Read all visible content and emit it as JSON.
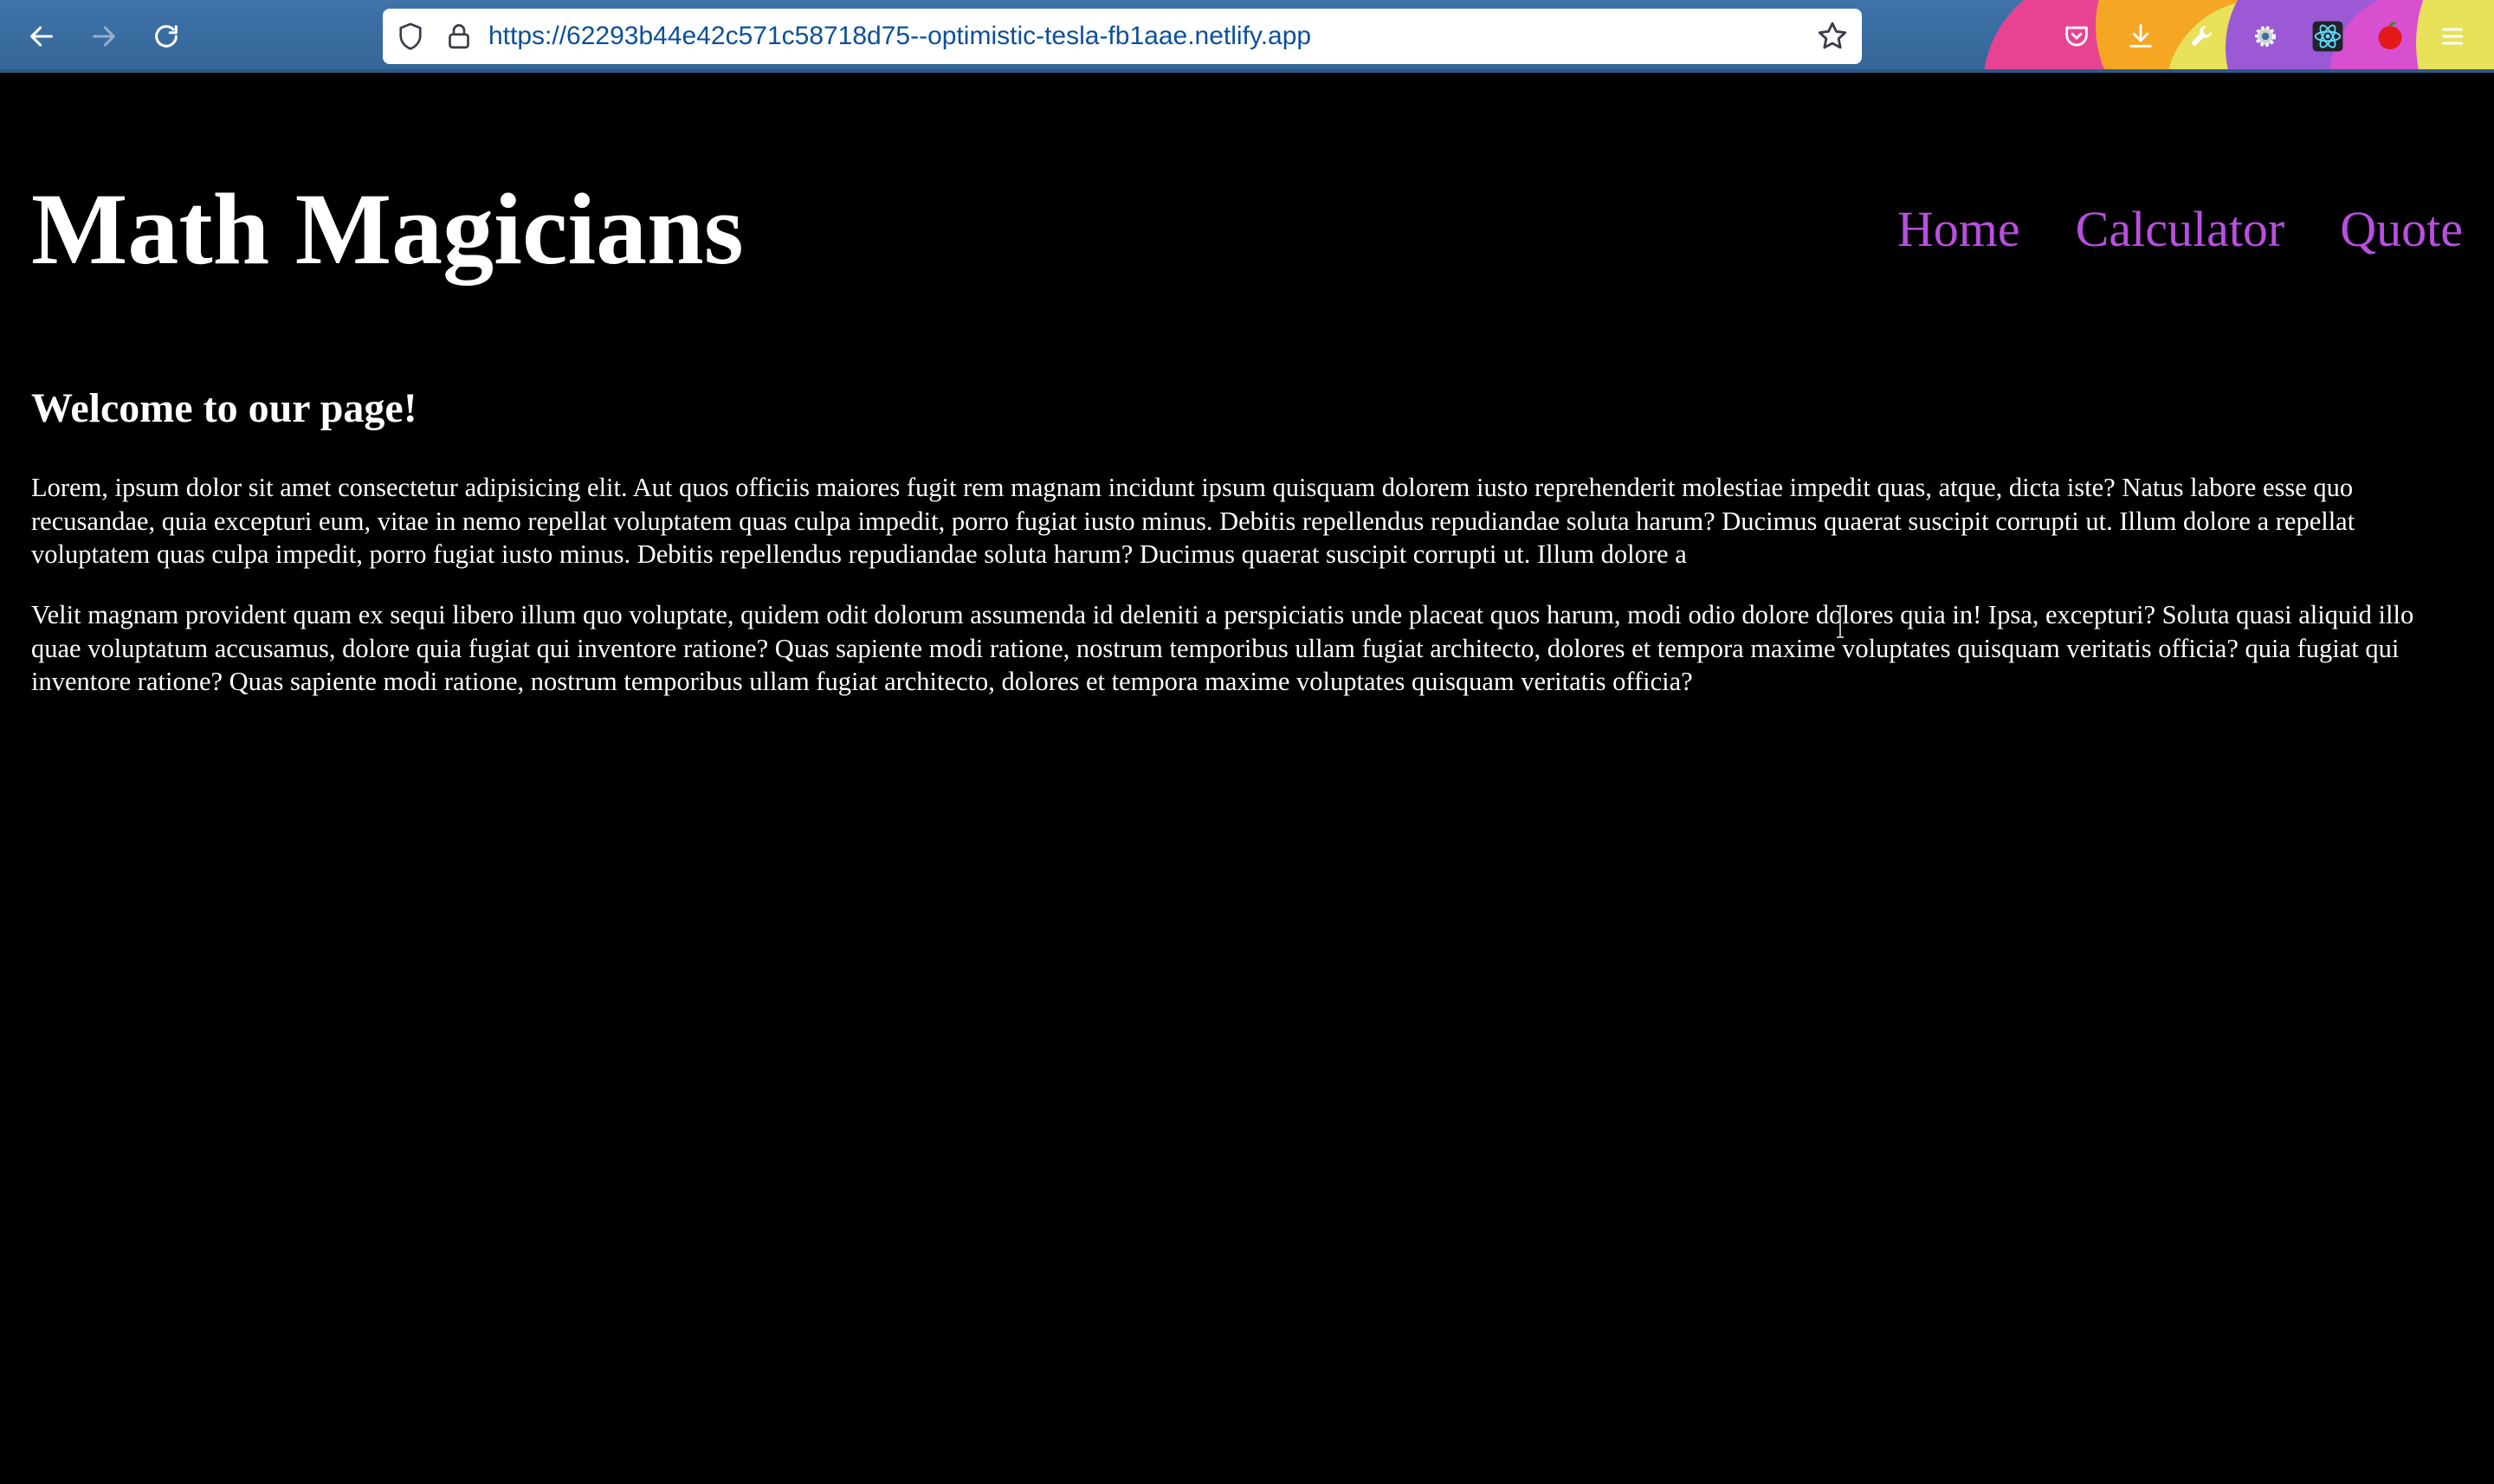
{
  "browser": {
    "url": "https://62293b44e42c571c58718d75--optimistic-tesla-fb1aae.netlify.app",
    "back_icon": "arrow-left-icon",
    "forward_icon": "arrow-right-icon",
    "reload_icon": "reload-icon",
    "toolbar_icons": [
      "pocket-icon",
      "download-icon",
      "wrench-icon",
      "gear-icon",
      "react-devtools-icon",
      "extension-icon",
      "menu-icon"
    ],
    "toolbar_color": "#3a6ea5"
  },
  "site": {
    "logo": "Math Magicians",
    "nav": [
      "Home",
      "Calculator",
      "Quote"
    ],
    "nav_color": "#b94fe0"
  },
  "content": {
    "heading": "Welcome to our page!",
    "paragraph1": "Lorem, ipsum dolor sit amet consectetur adipisicing elit. Aut quos officiis maiores fugit rem magnam incidunt ipsum quisquam dolorem iusto reprehenderit molestiae impedit quas, atque, dicta iste? Natus labore esse quo recusandae, quia excepturi eum, vitae in nemo repellat voluptatem quas culpa impedit, porro fugiat iusto minus. Debitis repellendus repudiandae soluta harum? Ducimus quaerat suscipit corrupti ut. Illum dolore a repellat voluptatem quas culpa impedit, porro fugiat iusto minus. Debitis repellendus repudiandae soluta harum? Ducimus quaerat suscipit corrupti ut. Illum dolore a",
    "paragraph2": "Velit magnam provident quam ex sequi libero illum quo voluptate, quidem odit dolorum assumenda id deleniti a perspiciatis unde placeat quos harum, modi odio dolore dolores quia in! Ipsa, excepturi? Soluta quasi aliquid illo quae voluptatum accusamus, dolore quia fugiat qui inventore ratione? Quas sapiente modi ratione, nostrum temporibus ullam fugiat architecto, dolores et tempora maxime voluptates quisquam veritatis officia? quia fugiat qui inventore ratione? Quas sapiente modi ratione, nostrum temporibus ullam fugiat architecto, dolores et tempora maxime voluptates quisquam veritatis officia?"
  }
}
